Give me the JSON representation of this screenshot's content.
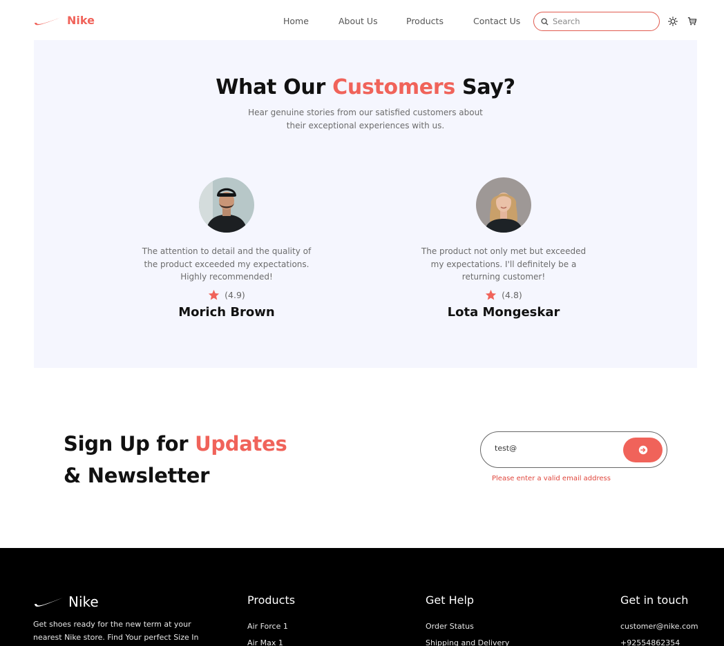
{
  "brand": {
    "name": "Nike",
    "accent_color": "#f0635a"
  },
  "nav": {
    "items": [
      "Home",
      "About Us",
      "Products",
      "Contact Us"
    ],
    "search_placeholder": "Search",
    "theme_icon": "sun-icon",
    "cart_icon": "cart-icon"
  },
  "testimonials": {
    "title_part1": "What Our ",
    "title_accent": "Customers",
    "title_part2": " Say?",
    "subtitle": "Hear genuine stories from our satisfied customers about their exceptional experiences with us.",
    "reviews": [
      {
        "quote": "The attention to detail and the quality of the product exceeded my expectations. Highly recommended!",
        "rating": "(4.9)",
        "name": "Morich Brown"
      },
      {
        "quote": "The product not only met but exceeded my expectations. I'll definitely be a returning customer!",
        "rating": "(4.8)",
        "name": "Lota Mongeskar"
      }
    ]
  },
  "newsletter": {
    "title_part1": "Sign Up for ",
    "title_accent": "Updates",
    "title_line2": "& Newsletter",
    "email_value": "test@",
    "error": "Please enter a valid email address"
  },
  "footer": {
    "brand": "Nike",
    "description": "Get shoes ready for the new term at your nearest Nike store. Find Your perfect Size In",
    "products": {
      "heading": "Products",
      "links": [
        "Air Force 1",
        "Air Max 1"
      ]
    },
    "help": {
      "heading": "Get Help",
      "links": [
        "Order Status",
        "Shipping and Delivery"
      ]
    },
    "contact": {
      "heading": "Get in touch",
      "links": [
        "customer@nike.com",
        "+92554862354"
      ]
    }
  }
}
